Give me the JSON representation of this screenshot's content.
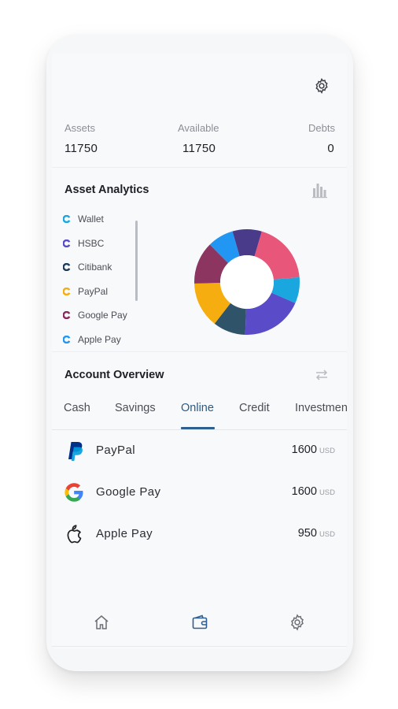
{
  "header": {
    "settings_icon": "gear-icon"
  },
  "stats": [
    {
      "label": "Assets",
      "value": "11750"
    },
    {
      "label": "Available",
      "value": "11750"
    },
    {
      "label": "Debts",
      "value": "0"
    }
  ],
  "analytics": {
    "title": "Asset Analytics",
    "toggle_icon": "bar-chart-icon",
    "legend": [
      {
        "label": "Wallet",
        "color": "#1aa7e0"
      },
      {
        "label": "HSBC",
        "color": "#5a4bc8"
      },
      {
        "label": "Citibank",
        "color": "#1f3b5c"
      },
      {
        "label": "PayPal",
        "color": "#f5ad0f"
      },
      {
        "label": "Google Pay",
        "color": "#8b2a5e"
      },
      {
        "label": "Apple Pay",
        "color": "#2196f3"
      }
    ],
    "donut_segments": [
      {
        "color": "#4a3a8a",
        "value": 9
      },
      {
        "color": "#e8567a",
        "value": 19
      },
      {
        "color": "#1aa7e0",
        "value": 8
      },
      {
        "color": "#5a4bc8",
        "value": 19
      },
      {
        "color": "#2f5368",
        "value": 10
      },
      {
        "color": "#f5ad0f",
        "value": 14
      },
      {
        "color": "#8b3560",
        "value": 13
      },
      {
        "color": "#2196f3",
        "value": 8
      }
    ]
  },
  "overview": {
    "title": "Account Overview",
    "swap_icon": "swap-arrows-icon",
    "tabs": [
      "Cash",
      "Savings",
      "Online",
      "Credit",
      "Investment"
    ],
    "active_tab": "Online",
    "accounts": [
      {
        "name": "PayPal",
        "amount": "1600",
        "currency": "USD",
        "icon": "paypal-logo-icon"
      },
      {
        "name": "Google Pay",
        "amount": "1600",
        "currency": "USD",
        "icon": "google-logo-icon"
      },
      {
        "name": "Apple Pay",
        "amount": "950",
        "currency": "USD",
        "icon": "apple-logo-icon"
      }
    ]
  },
  "bottom_nav": [
    {
      "name": "home-icon"
    },
    {
      "name": "wallet-icon"
    },
    {
      "name": "settings-icon"
    }
  ]
}
